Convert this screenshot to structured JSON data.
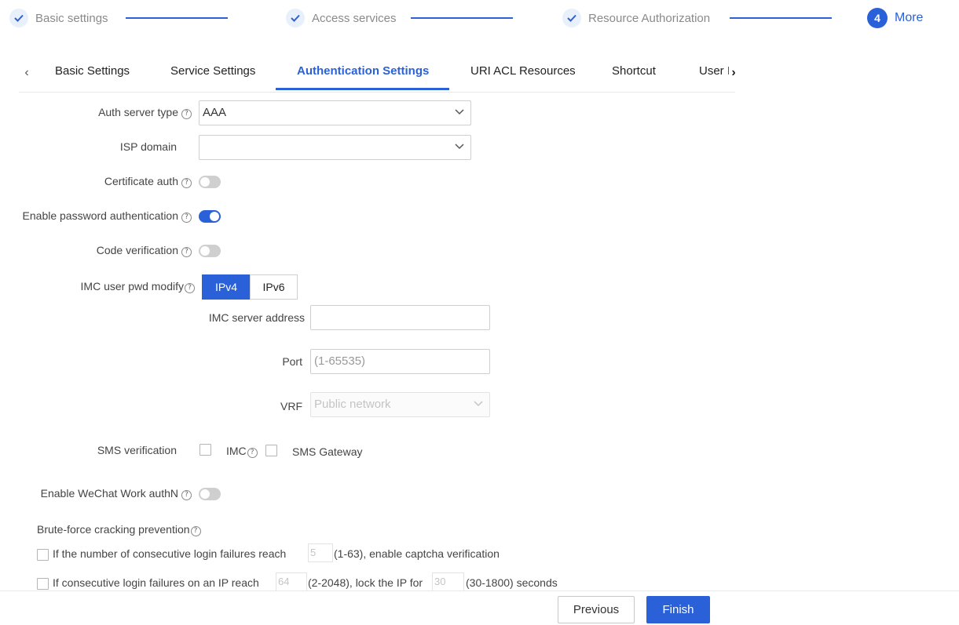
{
  "steps": [
    {
      "label": "Basic settings",
      "state": "done",
      "icon": "check-icon"
    },
    {
      "label": "Access services",
      "state": "done",
      "icon": "check-icon"
    },
    {
      "label": "Resource Authorization",
      "state": "done",
      "icon": "check-icon"
    },
    {
      "label": "More",
      "state": "active",
      "number": "4"
    }
  ],
  "tabs": {
    "prev_icon": "‹",
    "next_icon": "›",
    "items": [
      {
        "label": "Basic Settings"
      },
      {
        "label": "Service Settings"
      },
      {
        "label": "Authentication Settings",
        "active": true
      },
      {
        "label": "URI ACL Resources"
      },
      {
        "label": "Shortcut"
      },
      {
        "label": "User I"
      }
    ]
  },
  "form": {
    "help_glyph": "?",
    "auth_server_type": {
      "label": "Auth server type",
      "value": "AAA"
    },
    "isp_domain": {
      "label": "ISP domain",
      "value": ""
    },
    "certificate_auth": {
      "label": "Certificate auth",
      "on": false
    },
    "password_auth": {
      "label": "Enable password authentication",
      "on": true
    },
    "code_verification": {
      "label": "Code verification",
      "on": false
    },
    "imc_pwd_modify": {
      "label": "IMC user pwd modify",
      "options": [
        "IPv4",
        "IPv6"
      ],
      "selected": "IPv4"
    },
    "imc_server_address": {
      "label": "IMC server address",
      "value": ""
    },
    "port": {
      "label": "Port",
      "placeholder": "(1-65535)"
    },
    "vrf": {
      "label": "VRF",
      "value": "Public network"
    },
    "sms_verification": {
      "label": "SMS verification",
      "imc_label": "IMC",
      "gateway_label": "SMS Gateway"
    },
    "wechat_work": {
      "label": "Enable WeChat Work authN",
      "on": false
    },
    "brute_force": {
      "title": "Brute-force cracking prevention",
      "captcha": {
        "text_before": "If the number of consecutive login failures reach",
        "value": "5",
        "text_after": "(1-63), enable captcha verification"
      },
      "lock_ip": {
        "text_before": "If consecutive login failures on an IP reach",
        "value": "64",
        "text_mid": "(2-2048), lock the IP for",
        "value2": "30",
        "text_after": "(30-1800) seconds"
      }
    }
  },
  "footer": {
    "previous_label": "Previous",
    "finish_label": "Finish"
  },
  "colors": {
    "accent": "#2a61d9",
    "muted": "#8a8a8a"
  }
}
